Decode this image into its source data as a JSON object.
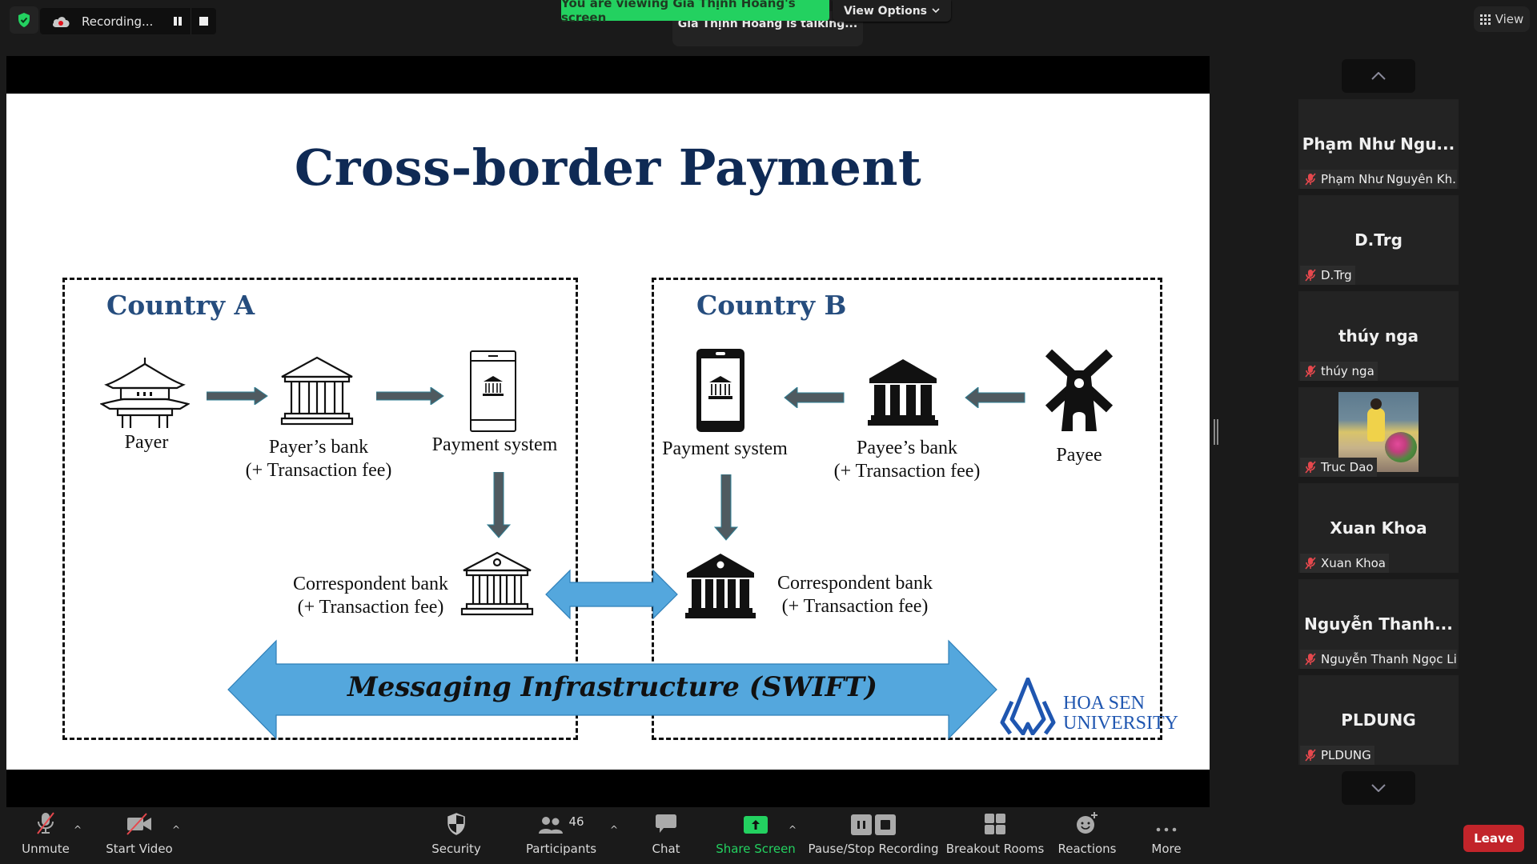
{
  "top_bar": {
    "recording_label": "Recording...",
    "viewing_banner": "You are viewing Gia Thịnh Hoàng's screen",
    "talking_indicator": "Gia Thịnh Hoàng is talking...",
    "view_options_label": "View Options",
    "view_label": "View"
  },
  "slide": {
    "title": "Cross-border Payment",
    "country_a": {
      "label": "Country A",
      "payer": "Payer",
      "payers_bank": "Payer’s bank",
      "payers_bank_fee": "(+ Transaction fee)",
      "payment_system": "Payment system",
      "correspondent_bank": "Correspondent bank",
      "correspondent_bank_fee": "(+ Transaction fee)"
    },
    "country_b": {
      "label": "Country B",
      "payee": "Payee",
      "payees_bank": "Payee’s bank",
      "payees_bank_fee": "(+ Transaction fee)",
      "payment_system": "Payment system",
      "correspondent_bank": "Correspondent bank",
      "correspondent_bank_fee": "(+ Transaction fee)"
    },
    "swift_label": "Messaging Infrastructure (SWIFT)",
    "logo_line1": "HOA SEN",
    "logo_line2": "UNIVERSITY",
    "colors": {
      "title": "#0f2a55",
      "country_label": "#264d7e",
      "flow_arrow": "#4f5a60",
      "swift_arrow": "#54a7dd",
      "logo": "#1f56b0"
    }
  },
  "participants": [
    {
      "display": "Phạm Như Ngu...",
      "name": "Phạm Như Nguyên Kh...",
      "muted": true,
      "has_video": false
    },
    {
      "display": "D.Trg",
      "name": "D.Trg",
      "muted": true,
      "has_video": false
    },
    {
      "display": "thúy nga",
      "name": "thúy nga",
      "muted": true,
      "has_video": false
    },
    {
      "display": "",
      "name": "Truc Dao",
      "muted": true,
      "has_video": true
    },
    {
      "display": "Xuan Khoa",
      "name": "Xuan Khoa",
      "muted": true,
      "has_video": false
    },
    {
      "display": "Nguyễn  Thanh...",
      "name": "Nguyễn Thanh Ngọc Li...",
      "muted": true,
      "has_video": false
    },
    {
      "display": "PLDUNG",
      "name": "PLDUNG",
      "muted": true,
      "has_video": false
    }
  ],
  "toolbar": {
    "unmute": "Unmute",
    "start_video": "Start Video",
    "security": "Security",
    "participants": "Participants",
    "participants_count": "46",
    "chat": "Chat",
    "share_screen": "Share Screen",
    "pause_stop_recording": "Pause/Stop Recording",
    "breakout_rooms": "Breakout Rooms",
    "reactions": "Reactions",
    "more": "More",
    "leave": "Leave",
    "colors": {
      "share_screen": "#23d160",
      "leave": "#c2242a",
      "muted_red": "#e5484d"
    }
  }
}
